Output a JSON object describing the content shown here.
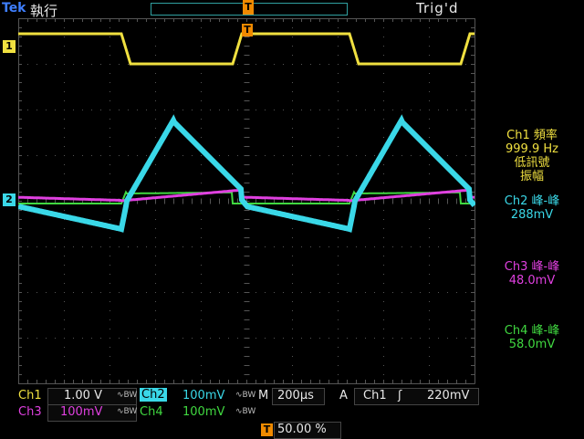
{
  "header": {
    "brand": "Tek",
    "run_state": "執行",
    "trig_state": "Trig'd",
    "trig_pos_symbol": "T"
  },
  "markers": {
    "ch1": "1",
    "ch2": "2",
    "trigger_time": "T"
  },
  "measurements": {
    "ch1": {
      "line1": "Ch1 頻率",
      "line2": "999.9 Hz",
      "line3": "低訊號",
      "line4": "振幅"
    },
    "ch2": {
      "line1": "Ch2 峰-峰",
      "line2": "288mV"
    },
    "ch3": {
      "line1": "Ch3 峰-峰",
      "line2": "48.0mV"
    },
    "ch4": {
      "line1": "Ch4 峰-峰",
      "line2": "58.0mV"
    }
  },
  "status": {
    "ch1_label": "Ch1",
    "ch1_scale": "1.00 V",
    "ch1_coupling": "∿BW",
    "ch2_label": "Ch2",
    "ch2_scale": "100mV",
    "ch2_coupling": "∿BW",
    "ch3_label": "Ch3",
    "ch3_scale": "100mV",
    "ch3_coupling": "∿BW",
    "ch4_label": "Ch4",
    "ch4_scale": "100mV",
    "ch4_coupling": "∿BW",
    "horiz_label": "M",
    "horiz_scale": "200µs",
    "trig_mode": "A",
    "trig_source": "Ch1",
    "trig_edge": "ʃ",
    "trig_level": "220mV",
    "tpos_symbol": "T",
    "tpos_value": "50.00 %"
  },
  "colors": {
    "ch1": "#f0e040",
    "ch2": "#3ad8e8",
    "ch3": "#e040e0",
    "ch4": "#40d840",
    "trigger": "#f08a00",
    "grid": "#555555"
  }
}
